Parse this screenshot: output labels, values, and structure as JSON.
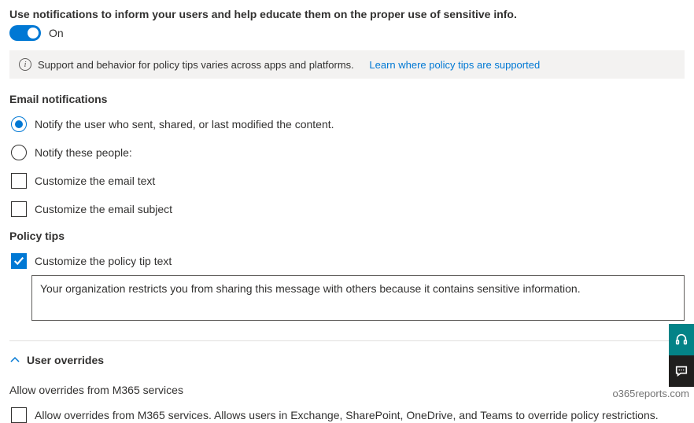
{
  "header": {
    "description": "Use notifications to inform your users and help educate them on the proper use of sensitive info.",
    "toggle_label": "On"
  },
  "info_bar": {
    "text": "Support and behavior for policy tips varies across apps and platforms.",
    "link": "Learn where policy tips are supported"
  },
  "email_notifications": {
    "heading": "Email notifications",
    "notify_sender_label": "Notify the user who sent, shared, or last modified the content.",
    "notify_people_label": "Notify these people:",
    "customize_text_label": "Customize the email text",
    "customize_subject_label": "Customize the email subject"
  },
  "policy_tips": {
    "heading": "Policy tips",
    "customize_label": "Customize the policy tip text",
    "text_value": "Your organization restricts you from sharing this message with others because it contains sensitive information."
  },
  "user_overrides": {
    "heading": "User overrides",
    "subheading": "Allow overrides from M365 services",
    "allow_label": "Allow overrides from M365 services. Allows users in Exchange, SharePoint, OneDrive, and Teams to override policy restrictions."
  },
  "watermark": "o365reports.com"
}
